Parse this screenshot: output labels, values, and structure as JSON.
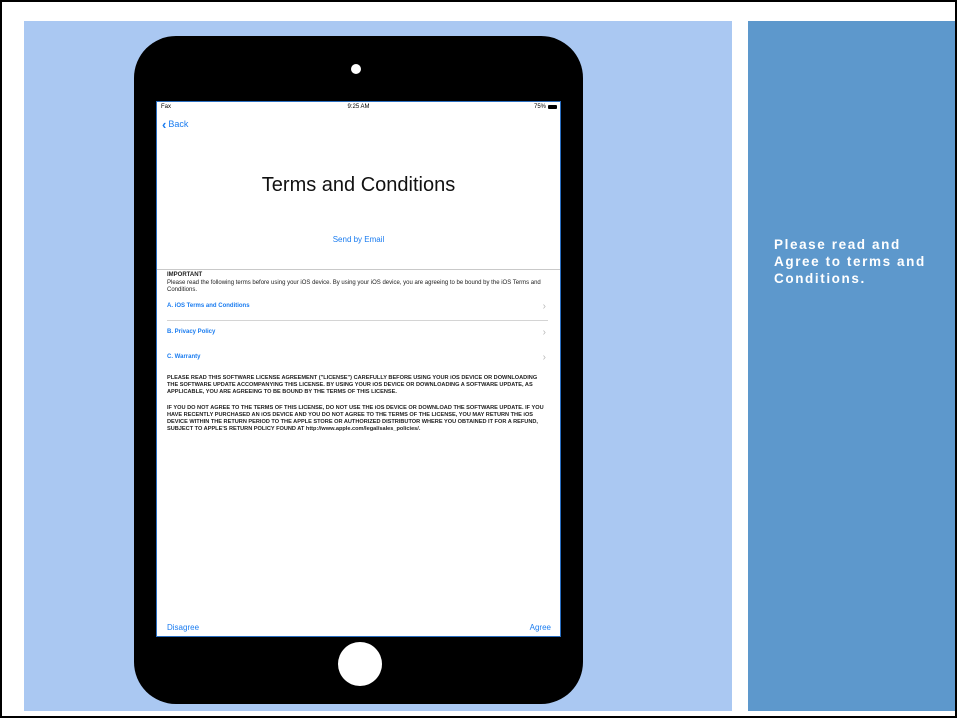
{
  "caption": "Please read and Agree to terms and Conditions.",
  "device": {
    "status_bar": {
      "carrier": "Fax",
      "time": "9:25 AM",
      "battery": "75%"
    },
    "back_label": "Back",
    "title": "Terms and Conditions",
    "send_email": "Send by Email",
    "important_heading": "IMPORTANT",
    "important_text": "Please read the following terms before using your iOS device. By using your iOS device, you are agreeing to be bound by the iOS Terms and Conditions.",
    "links": [
      {
        "label": "A. iOS Terms and Conditions"
      },
      {
        "label": "B. Privacy Policy"
      },
      {
        "label": "C. Warranty"
      }
    ],
    "license_paragraph_1": "PLEASE READ THIS SOFTWARE LICENSE AGREEMENT (\"LICENSE\") CAREFULLY BEFORE USING YOUR iOS DEVICE OR DOWNLOADING THE SOFTWARE UPDATE ACCOMPANYING THIS LICENSE. BY USING YOUR iOS DEVICE OR DOWNLOADING A SOFTWARE UPDATE, AS APPLICABLE, YOU ARE AGREEING TO BE BOUND BY THE TERMS OF THIS LICENSE.",
    "license_paragraph_2": "IF YOU DO NOT AGREE TO THE TERMS OF THIS LICENSE, DO NOT USE THE iOS DEVICE OR DOWNLOAD THE SOFTWARE UPDATE. IF YOU HAVE RECENTLY PURCHASED AN iOS DEVICE AND YOU DO NOT AGREE TO THE TERMS OF THE LICENSE, YOU MAY RETURN THE iOS DEVICE WITHIN THE RETURN PERIOD TO THE APPLE STORE OR AUTHORIZED DISTRIBUTOR WHERE YOU OBTAINED IT FOR A REFUND, SUBJECT TO APPLE'S RETURN POLICY FOUND AT http://www.apple.com/legal/sales_policies/.",
    "disagree_label": "Disagree",
    "agree_label": "Agree"
  },
  "colors": {
    "left_panel": "#aac8f2",
    "right_panel": "#5d98cc",
    "ios_blue": "#1a7cf0"
  }
}
